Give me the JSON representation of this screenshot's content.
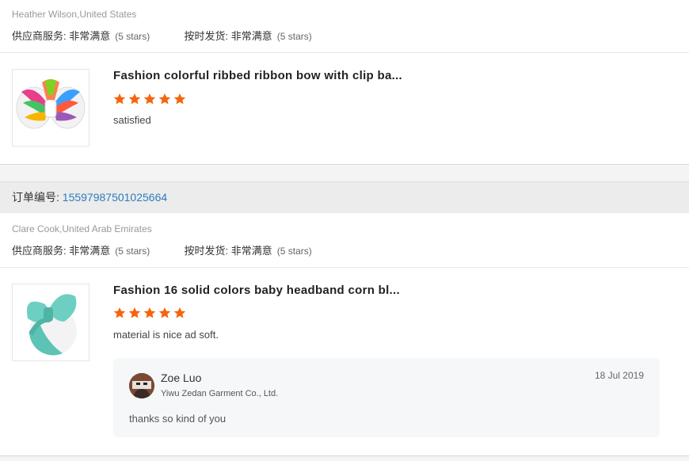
{
  "ratings_labels": {
    "supplier_service": "供应商服务:",
    "on_time_shipment": "按时发货:"
  },
  "reviews": [
    {
      "reviewer": "Heather Wilson,United States",
      "supplier_service_value": "非常满意",
      "supplier_service_stars": "(5 stars)",
      "on_time_value": "非常满意",
      "on_time_stars": "(5 stars)",
      "product_title": "Fashion colorful ribbed ribbon bow with clip ba...",
      "product_image": "rainbow-ribbon-bow-clip",
      "rating": 5,
      "comment": "satisfied"
    },
    {
      "order_label": "订单编号:",
      "order_number": "15597987501025664",
      "reviewer": "Clare Cook,United Arab Emirates",
      "supplier_service_value": "非常满意",
      "supplier_service_stars": "(5 stars)",
      "on_time_value": "非常满意",
      "on_time_stars": "(5 stars)",
      "product_title": "Fashion 16 solid colors baby headband corn bl...",
      "product_image": "mint-bow-headband",
      "rating": 5,
      "comment": "material is nice ad soft.",
      "reply": {
        "name": "Zoe Luo",
        "company": "Yiwu Zedan Garment Co., Ltd.",
        "date": "18 Jul 2019",
        "text": "thanks so kind of you"
      }
    }
  ],
  "colors": {
    "star": "#f6640c",
    "order_link": "#2e7bbf",
    "order_bar_bg": "#ececec",
    "reply_bg": "#f6f7f9"
  }
}
